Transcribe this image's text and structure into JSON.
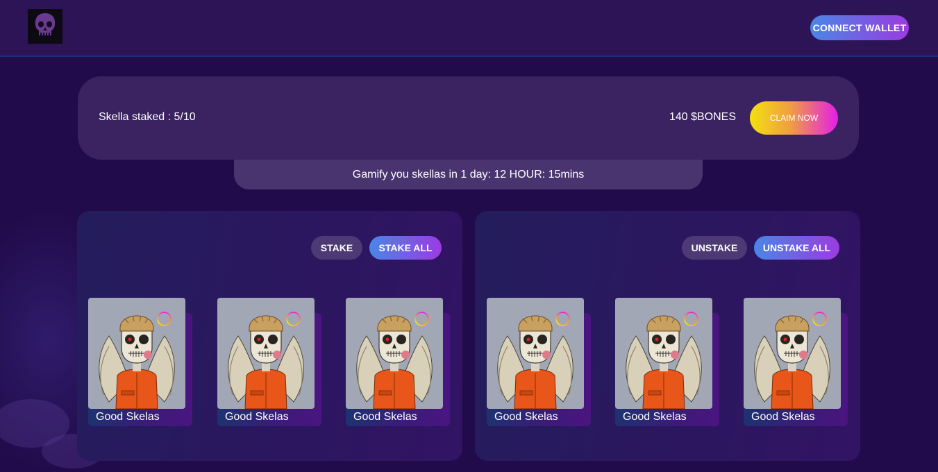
{
  "header": {
    "logo_icon": "skull-logo-icon",
    "connect_label": "CONNECT WALLET"
  },
  "stats": {
    "staked_text": "Skella staked : 5/10",
    "bones_text": "140 $BONES",
    "claim_label": "CLAIM NOW",
    "timer_text": "Gamify you skellas in 1 day: 12 HOUR: 15mins"
  },
  "stake_panel": {
    "stake_label": "STAKE",
    "stake_all_label": "STAKE ALL",
    "cards": [
      {
        "name": "Good Skelas"
      },
      {
        "name": "Good Skelas"
      },
      {
        "name": "Good Skelas"
      }
    ]
  },
  "unstake_panel": {
    "unstake_label": "UNSTAKE",
    "unstake_all_label": "UNSTAKE ALL",
    "cards": [
      {
        "name": "Good Skelas"
      },
      {
        "name": "Good Skelas"
      },
      {
        "name": "Good Skelas"
      }
    ]
  },
  "colors": {
    "background": "#220b4a",
    "topbar": "#2c1456",
    "card_panel": "#3b2260",
    "accent_gradient_start": "#4a86e6",
    "accent_gradient_end": "#9b3be0",
    "claim_gradient": [
      "#f4e010",
      "#f0a040",
      "#e41ee8"
    ]
  }
}
